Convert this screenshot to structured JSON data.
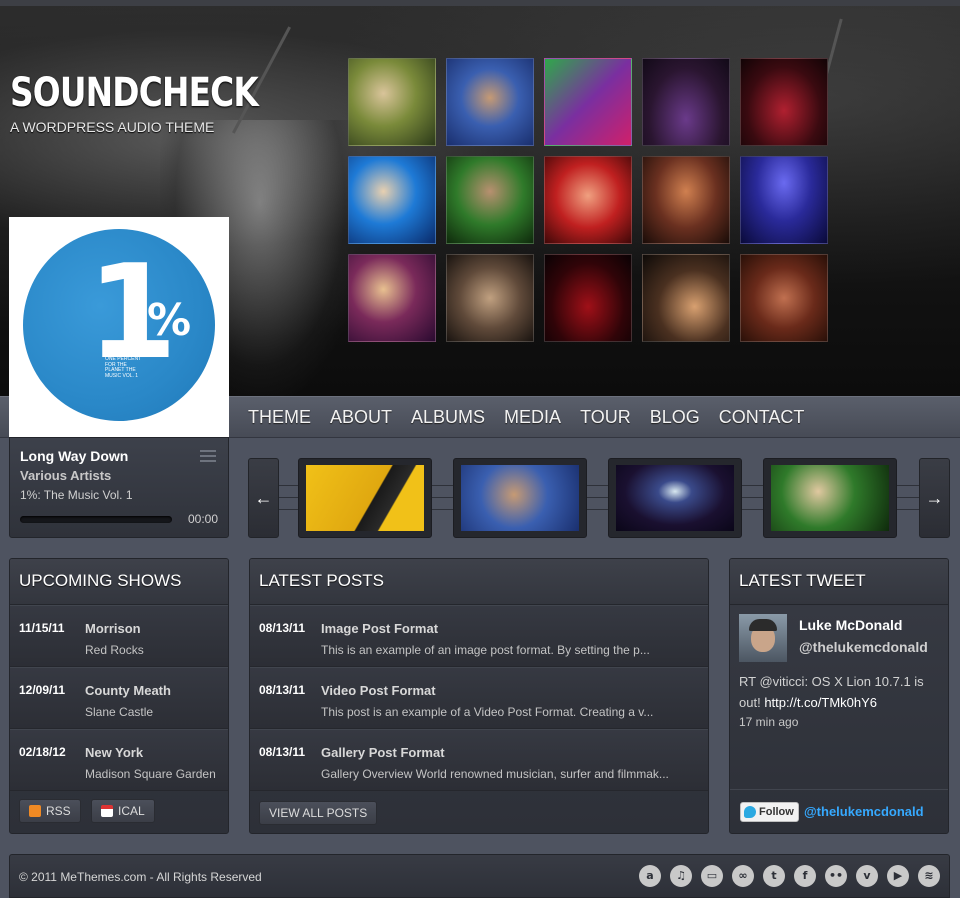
{
  "site": {
    "logo": "SOUNDCHECK",
    "tagline": "A WORDPRESS AUDIO THEME"
  },
  "nav": [
    "THEME",
    "ABOUT",
    "ALBUMS",
    "MEDIA",
    "TOUR",
    "BLOG",
    "CONTACT"
  ],
  "album_art": {
    "big_number": "1",
    "percent": "%",
    "small_text": "ONE PERCENT FOR THE PLANET THE MUSIC VOL. 1"
  },
  "player": {
    "song": "Long Way Down",
    "artist": "Various Artists",
    "album": "1%: The Music Vol. 1",
    "time": "00:00",
    "progress": 0
  },
  "carousel": {
    "prev_label": "←",
    "next_label": "→"
  },
  "upcoming_shows": {
    "title": "UPCOMING SHOWS",
    "items": [
      {
        "date": "11/15/11",
        "city": "Morrison",
        "venue": "Red Rocks"
      },
      {
        "date": "12/09/11",
        "city": "County Meath",
        "venue": "Slane Castle"
      },
      {
        "date": "02/18/12",
        "city": "New York",
        "venue": "Madison Square Garden"
      }
    ],
    "rss_label": "RSS",
    "ical_label": "ICAL"
  },
  "latest_posts": {
    "title": "LATEST POSTS",
    "items": [
      {
        "date": "08/13/11",
        "title": "Image Post Format",
        "excerpt": "This is an example of an image post format. By setting the p..."
      },
      {
        "date": "08/13/11",
        "title": "Video Post Format",
        "excerpt": "This post is an example of a Video Post Format. Creating a v..."
      },
      {
        "date": "08/13/11",
        "title": "Gallery Post Format",
        "excerpt": "Gallery Overview World renowned musician, surfer and filmmak..."
      }
    ],
    "view_all_label": "VIEW ALL POSTS"
  },
  "latest_tweet": {
    "title": "LATEST TWEET",
    "name": "Luke McDonald",
    "handle": "@thelukemcdonald",
    "text_prefix": "RT @viticci: OS X Lion 10.7.1 is out!",
    "link": "http://t.co/TMk0hY6",
    "time": "17 min ago",
    "follow_label": "Follow",
    "follow_handle": "@thelukemcdonald"
  },
  "footer": {
    "copyright": "© 2011 MeThemes.com - All Rights Reserved",
    "social_icons": [
      "amazon-icon",
      "itunes-icon",
      "lastfm-icon",
      "lastfm-alt-icon",
      "twitter-icon",
      "facebook-icon",
      "flickr-icon",
      "vimeo-icon",
      "youtube-icon",
      "rss-icon"
    ]
  },
  "colors": {
    "background": "#4e5360",
    "panel": "#33363e",
    "twitter_blue": "#36a9ff",
    "album_blue": "#2a88c8"
  }
}
